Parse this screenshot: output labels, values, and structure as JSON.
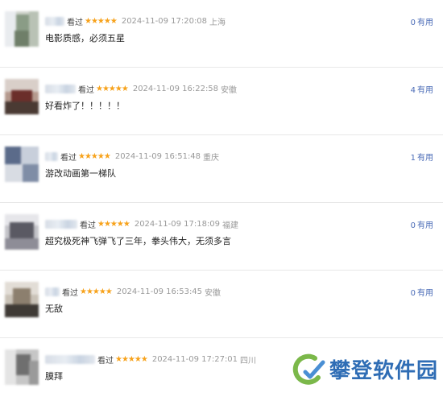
{
  "comments": [
    {
      "status": "看过",
      "stars": "★★★★★",
      "time": "2024-11-09 17:20:08",
      "location": "上海",
      "text": "电影质感，必须五星",
      "useful_count": "0",
      "useful_label": "有用"
    },
    {
      "status": "看过",
      "stars": "★★★★★",
      "time": "2024-11-09 16:22:58",
      "location": "安徽",
      "text": "好看炸了！！！！！",
      "useful_count": "4",
      "useful_label": "有用"
    },
    {
      "status": "看过",
      "stars": "★★★★★",
      "time": "2024-11-09 16:51:48",
      "location": "重庆",
      "text": "游改动画第一梯队",
      "useful_count": "1",
      "useful_label": "有用"
    },
    {
      "status": "看过",
      "stars": "★★★★★",
      "time": "2024-11-09 17:18:09",
      "location": "福建",
      "text": "超究极死神飞弹飞了三年，拳头伟大，无须多言",
      "useful_count": "0",
      "useful_label": "有用"
    },
    {
      "status": "看过",
      "stars": "★★★★★",
      "time": "2024-11-09 16:53:45",
      "location": "安徽",
      "text": "无敌",
      "useful_count": "0",
      "useful_label": "有用"
    },
    {
      "status": "看过",
      "stars": "★★★★★",
      "time": "2024-11-09 17:27:01",
      "location": "四川",
      "text": "膜拜",
      "useful_count": "",
      "useful_label": ""
    }
  ],
  "watermark": {
    "text": "攀登软件园"
  },
  "colors": {
    "star": "#f7a21b",
    "link": "#4b6cb7",
    "meta": "#999999"
  }
}
